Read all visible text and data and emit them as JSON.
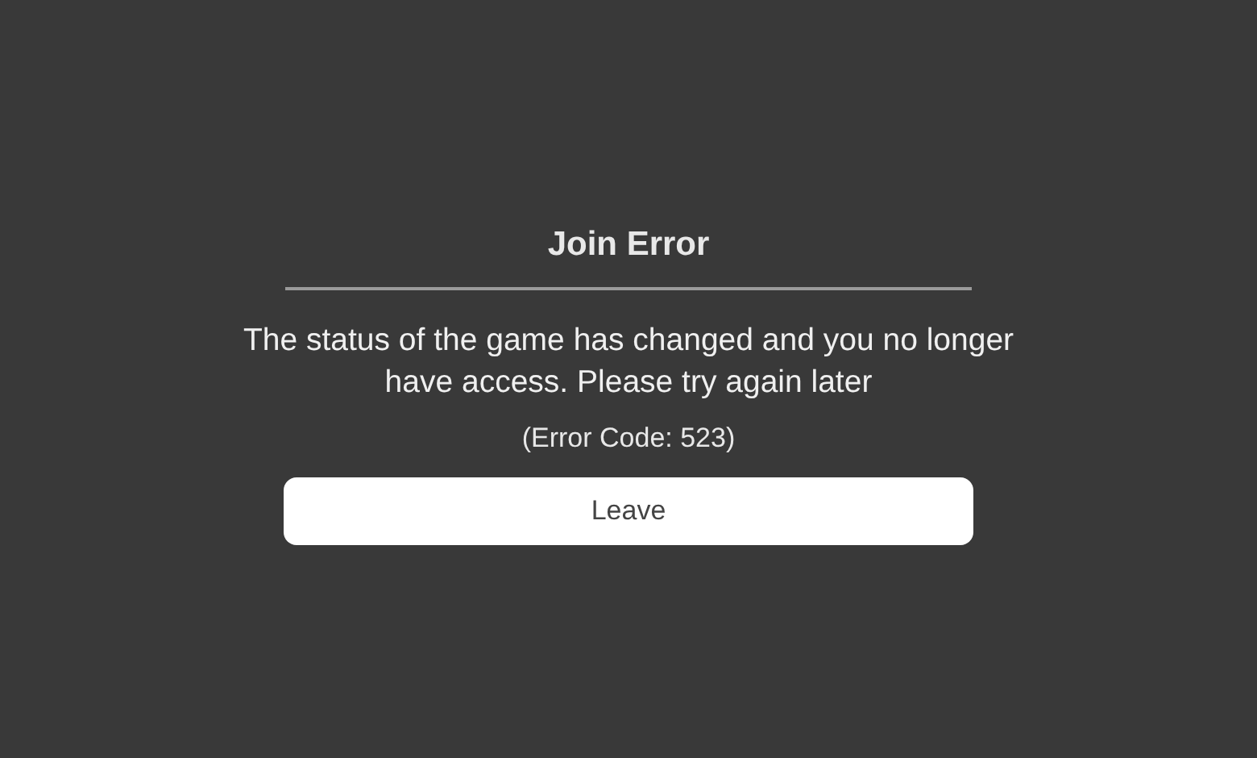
{
  "dialog": {
    "title": "Join Error",
    "message": "The status of the game has changed and you no longer have access. Please try again later",
    "error_code": "(Error Code: 523)",
    "buttons": [
      "Leave"
    ]
  }
}
